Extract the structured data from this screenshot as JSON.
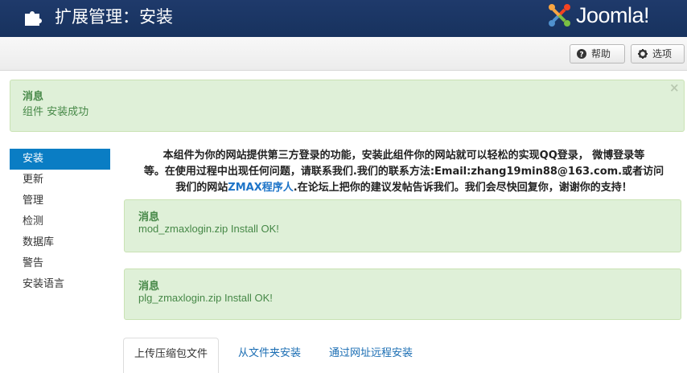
{
  "header": {
    "title": "扩展管理：安装",
    "brand": "Joomla!"
  },
  "toolbar": {
    "help_label": "帮助",
    "options_label": "选项"
  },
  "message": {
    "heading": "消息",
    "text": "组件 安装成功",
    "close": "×"
  },
  "sidebar": {
    "items": [
      {
        "label": "安装"
      },
      {
        "label": "更新"
      },
      {
        "label": "管理"
      },
      {
        "label": "检测"
      },
      {
        "label": "数据库"
      },
      {
        "label": "警告"
      },
      {
        "label": "安装语言"
      }
    ]
  },
  "description": {
    "line1": "本组件为你的网站提供第三方登录的功能，安装此组件你的网站就可以轻松的实现QQ登录，  微博登录等",
    "line2": "等。在使用过程中出现任何问题，请联系我们.我们的联系方法:Email:zhang19min88@163.com.或者访问",
    "line3_before": "我们的网站",
    "line3_link": "ZMAX程序人",
    "line3_after": ".在论坛上把你的建议发帖告诉我们。我们会尽快回复你，谢谢你的支持！"
  },
  "install_messages": [
    {
      "heading": "消息",
      "text": "mod_zmaxlogin.zip Install OK!"
    },
    {
      "heading": "消息",
      "text": "plg_zmaxlogin.zip Install OK!"
    }
  ],
  "tabs": [
    {
      "label": "上传压缩包文件"
    },
    {
      "label": "从文件夹安装"
    },
    {
      "label": "通过网址远程安装"
    }
  ],
  "colors": {
    "header_bg": "#1f3a6b",
    "active_nav": "#0a7dc4",
    "success_bg": "#dff0d8",
    "success_text": "#468847",
    "link": "#1d74c8"
  },
  "icons": [
    "puzzle-icon",
    "joomla-logo-icon",
    "help-icon",
    "gear-icon",
    "close-icon"
  ]
}
